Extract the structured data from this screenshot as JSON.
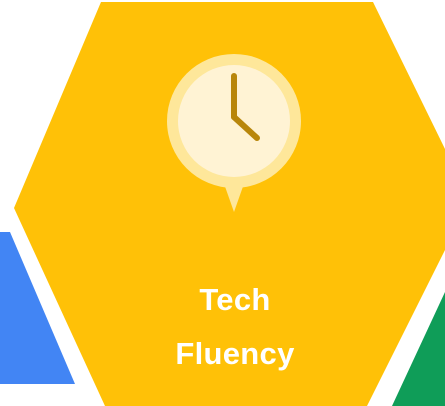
{
  "card": {
    "title_line_1": "Tech",
    "title_line_2": "Fluency",
    "icon": "clock-icon"
  },
  "colors": {
    "hexagon_main": "#FFC107",
    "hexagon_left": "#4285F4",
    "hexagon_right": "#0F9D58",
    "icon_outer": "#FEE79A",
    "icon_inner": "#FFF3D4",
    "clock_hands": "#B8860B",
    "text": "#FFFFFF"
  }
}
